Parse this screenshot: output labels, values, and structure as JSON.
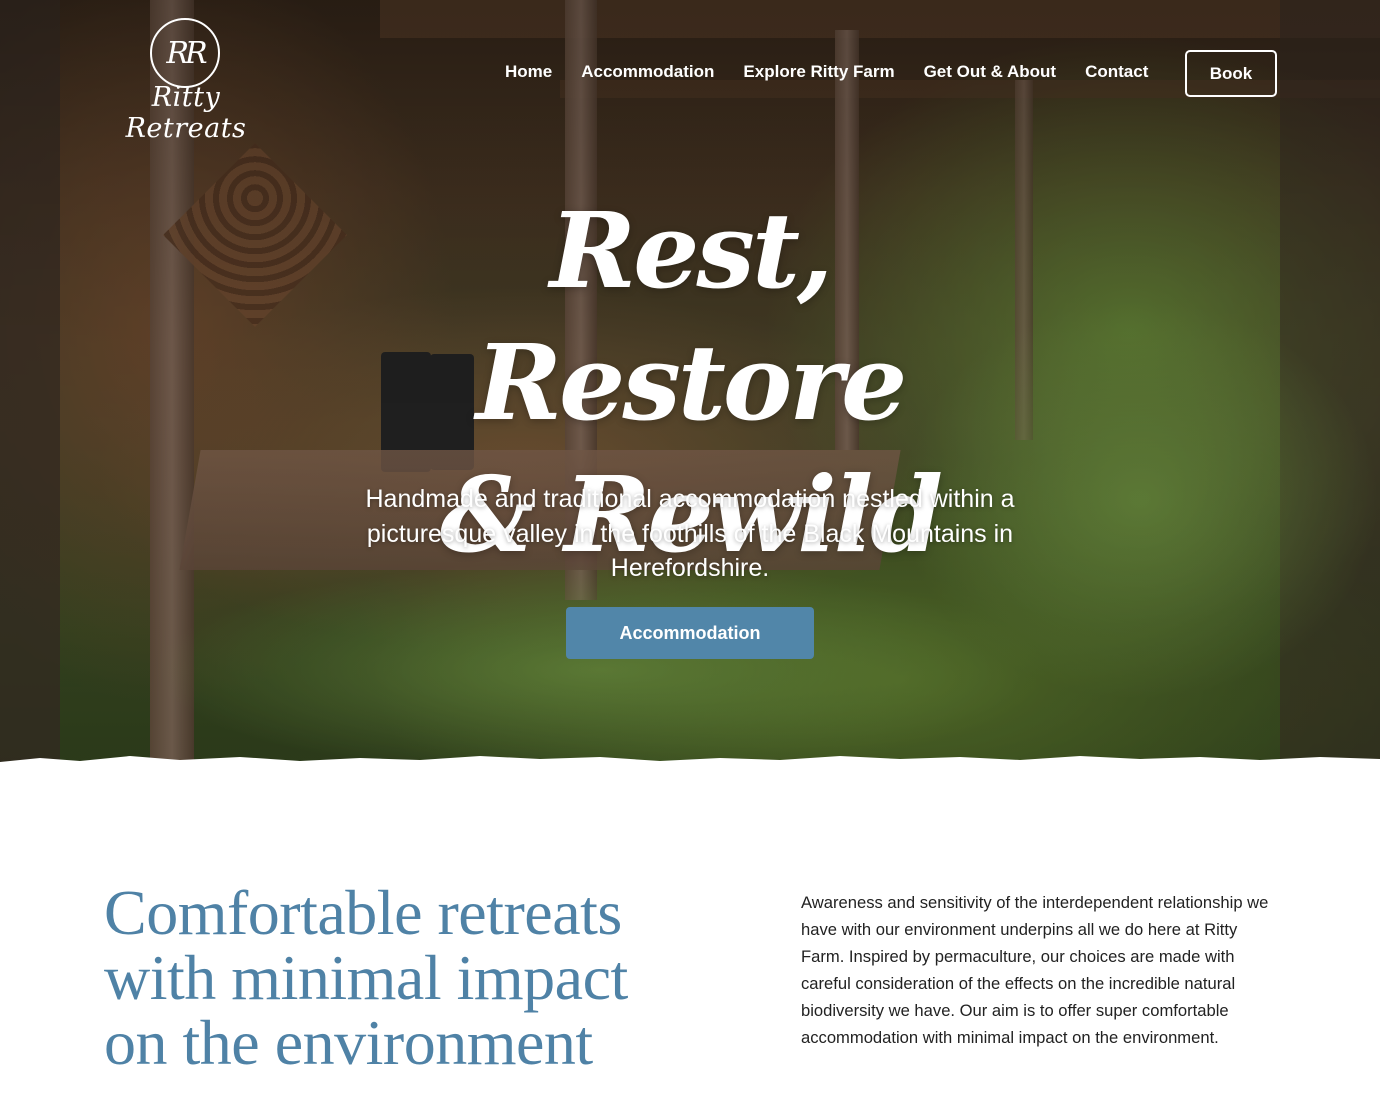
{
  "brand": {
    "monogram": "RR",
    "name": "Ritty Retreats"
  },
  "nav": {
    "items": [
      {
        "label": "Home"
      },
      {
        "label": "Accommodation"
      },
      {
        "label": "Explore Ritty Farm"
      },
      {
        "label": "Get Out & About"
      },
      {
        "label": "Contact"
      }
    ],
    "book_label": "Book"
  },
  "hero": {
    "title_line1": "Rest, Restore",
    "title_line2": "& Rewild",
    "subtitle": "Handmade and traditional accommodation nestled within a picturesque valley in the foothills of the Black Mountains in Herefordshire.",
    "cta_label": "Accommodation"
  },
  "intro": {
    "heading_line1": "Comfortable retreats",
    "heading_line2": "with minimal impact",
    "heading_line3": "on the environment",
    "body": "Awareness and sensitivity of the interdependent relationship we have with our environment underpins all we do here at Ritty Farm. Inspired by permaculture, our choices are made with careful consideration of the effects on the incredible natural biodiversity we have. Our aim is to offer super comfortable accommodation with minimal impact on the environment."
  },
  "colors": {
    "accent_blue": "#5186a9",
    "heading_blue": "#4f82a6",
    "text_dark": "#222222",
    "white": "#ffffff"
  }
}
